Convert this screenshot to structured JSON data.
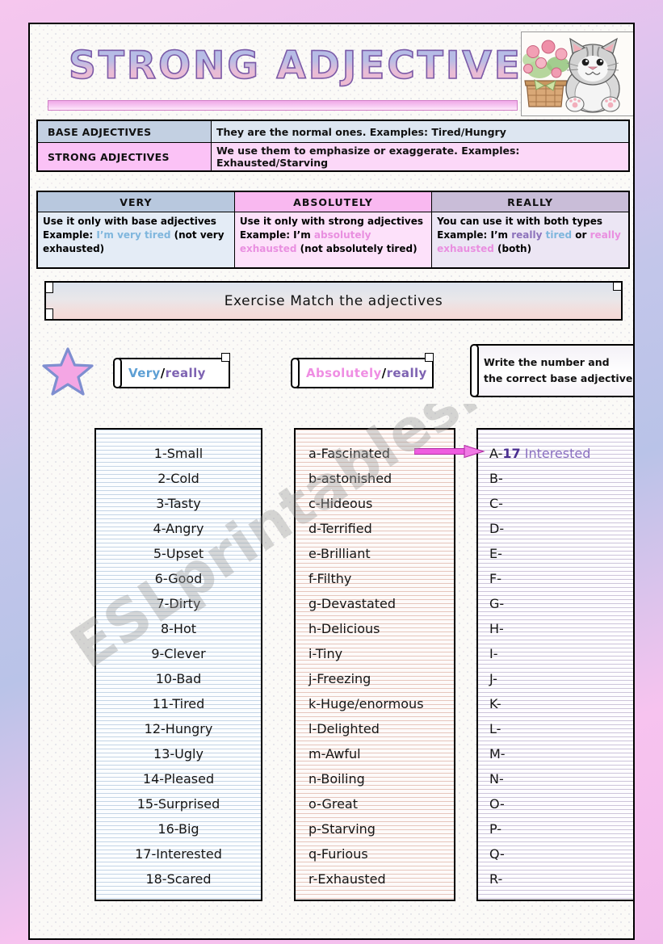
{
  "page": {
    "title": "STRONG ADJECTIVES",
    "image_caption": "kitten-with-flower-basket"
  },
  "definitions": {
    "rows": [
      {
        "label": "BASE ADJECTIVES",
        "text": "They are the normal ones. Examples: Tired/Hungry"
      },
      {
        "label": "STRONG ADJECTIVES",
        "text": "We use them to emphasize or exaggerate. Examples: Exhausted/Starving"
      }
    ]
  },
  "usage": {
    "headers": [
      "VERY",
      "ABSOLUTELY",
      "REALLY"
    ],
    "very": {
      "rule": "Use it only with base adjectives",
      "example_label": "Example: ",
      "example_colored": "I’m very tired",
      "example_rest": " (not very exhausted)"
    },
    "absolutely": {
      "rule": "Use it only with strong adjectives",
      "example_label": "Example: I’m ",
      "example_colored": "absolutely exhausted",
      "example_rest": " (not absolutely tired)"
    },
    "really": {
      "rule": "You can use it with both types",
      "example_label": "Example: I’m ",
      "really1": "really",
      "tired": " tired",
      "or": " or ",
      "really2": "really exhausted",
      "example_rest": " (both)"
    }
  },
  "banner": {
    "text": "Exercise    Match the adjectives"
  },
  "labels": {
    "col1": {
      "first": "Very",
      "sep": "/",
      "second": "really"
    },
    "col2": {
      "first": "Absolutely",
      "sep": "/",
      "second": "really"
    },
    "col3": {
      "line1": "Write the number and",
      "line2": "the correct base adjective"
    }
  },
  "lists": {
    "base": [
      "1-Small",
      "2-Cold",
      "3-Tasty",
      "4-Angry",
      "5-Upset",
      "6-Good",
      "7-Dirty",
      "8-Hot",
      "9-Clever",
      "10-Bad",
      "11-Tired",
      "12-Hungry",
      "13-Ugly",
      "14-Pleased",
      "15-Surprised",
      "16-Big",
      "17-Interested",
      "18-Scared"
    ],
    "strong": [
      "a-Fascinated",
      "b-astonished",
      "c-Hideous",
      "d-Terrified",
      "e-Brilliant",
      "f-Filthy",
      "g-Devastated",
      "h-Delicious",
      "i-Tiny",
      "j-Freezing",
      "k-Huge/enormous",
      "l-Delighted",
      "m-Awful",
      "n-Boiling",
      "o-Great",
      "p-Starving",
      "q-Furious",
      "r-Exhausted"
    ],
    "answers": [
      {
        "letter": "A-",
        "number": "17",
        "word": " Interested"
      },
      {
        "letter": "B-",
        "number": "",
        "word": ""
      },
      {
        "letter": "C-",
        "number": "",
        "word": ""
      },
      {
        "letter": "D-",
        "number": "",
        "word": ""
      },
      {
        "letter": "E-",
        "number": "",
        "word": ""
      },
      {
        "letter": "F-",
        "number": "",
        "word": ""
      },
      {
        "letter": "G-",
        "number": "",
        "word": ""
      },
      {
        "letter": "H-",
        "number": "",
        "word": ""
      },
      {
        "letter": "I-",
        "number": "",
        "word": ""
      },
      {
        "letter": "J-",
        "number": "",
        "word": ""
      },
      {
        "letter": "K-",
        "number": "",
        "word": ""
      },
      {
        "letter": "L-",
        "number": "",
        "word": ""
      },
      {
        "letter": "M-",
        "number": "",
        "word": ""
      },
      {
        "letter": "N-",
        "number": "",
        "word": ""
      },
      {
        "letter": "O-",
        "number": "",
        "word": ""
      },
      {
        "letter": "P-",
        "number": "",
        "word": ""
      },
      {
        "letter": "Q-",
        "number": "",
        "word": ""
      },
      {
        "letter": "R-",
        "number": "",
        "word": ""
      }
    ]
  },
  "watermark": {
    "text": "ESLprintables.com"
  },
  "colors": {
    "base_header": "#c3d0e2",
    "strong_header": "#fbc2f6",
    "very_header": "#b8c8de",
    "absolutely_header": "#f9b8f0",
    "really_header": "#c9bdd8",
    "blue_text": "#7fb6dd",
    "pink_text": "#e98fe0",
    "purple_text": "#8c72bb",
    "arrow": "#e857d8",
    "star_fill": "#f4a6e4",
    "star_stroke": "#7f8fd0"
  }
}
